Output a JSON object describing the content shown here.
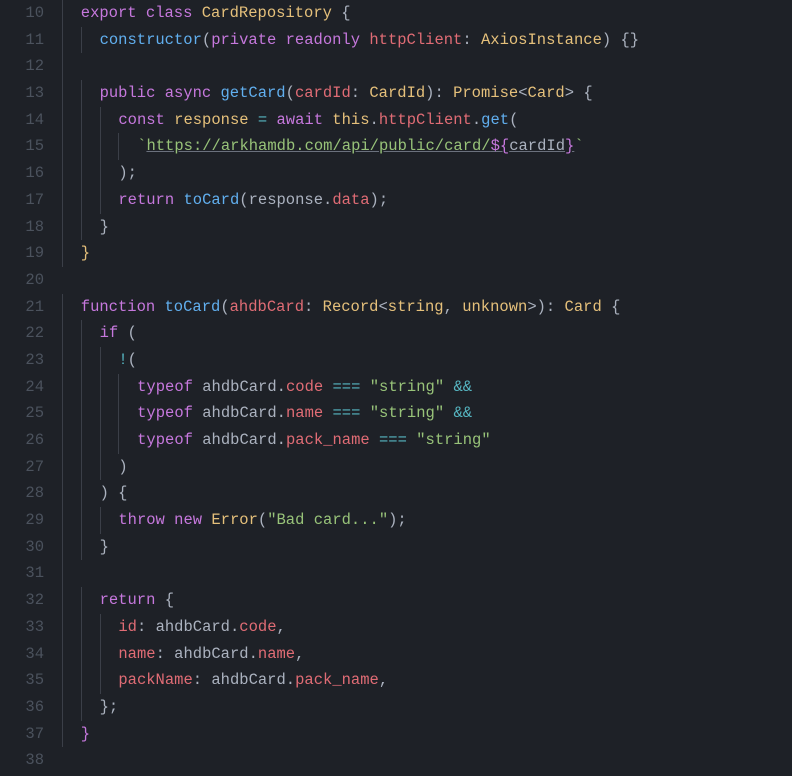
{
  "lines": [
    {
      "num": 10,
      "indent": 1,
      "tokens": [
        {
          "t": "export ",
          "c": "tok-keyword"
        },
        {
          "t": "class ",
          "c": "tok-keyword"
        },
        {
          "t": "CardRepository ",
          "c": "tok-classname"
        },
        {
          "t": "{",
          "c": "tok-brace"
        }
      ]
    },
    {
      "num": 11,
      "indent": 2,
      "tokens": [
        {
          "t": "constructor",
          "c": "tok-funcname"
        },
        {
          "t": "(",
          "c": "tok-punct"
        },
        {
          "t": "private ",
          "c": "tok-keyword"
        },
        {
          "t": "readonly ",
          "c": "tok-keyword"
        },
        {
          "t": "httpClient",
          "c": "tok-param"
        },
        {
          "t": ": ",
          "c": "tok-punct"
        },
        {
          "t": "AxiosInstance",
          "c": "tok-type"
        },
        {
          "t": ") {}",
          "c": "tok-punct"
        }
      ]
    },
    {
      "num": 12,
      "indent": 1,
      "tokens": []
    },
    {
      "num": 13,
      "indent": 2,
      "tokens": [
        {
          "t": "public ",
          "c": "tok-keyword"
        },
        {
          "t": "async ",
          "c": "tok-keyword"
        },
        {
          "t": "getCard",
          "c": "tok-funcname"
        },
        {
          "t": "(",
          "c": "tok-punct"
        },
        {
          "t": "cardId",
          "c": "tok-param"
        },
        {
          "t": ": ",
          "c": "tok-punct"
        },
        {
          "t": "CardId",
          "c": "tok-type"
        },
        {
          "t": "): ",
          "c": "tok-punct"
        },
        {
          "t": "Promise",
          "c": "tok-type"
        },
        {
          "t": "<",
          "c": "tok-punct"
        },
        {
          "t": "Card",
          "c": "tok-type"
        },
        {
          "t": "> {",
          "c": "tok-punct"
        }
      ]
    },
    {
      "num": 14,
      "indent": 3,
      "tokens": [
        {
          "t": "const ",
          "c": "tok-keyword"
        },
        {
          "t": "response ",
          "c": "tok-const"
        },
        {
          "t": "= ",
          "c": "tok-operator"
        },
        {
          "t": "await ",
          "c": "tok-keyword"
        },
        {
          "t": "this",
          "c": "tok-this"
        },
        {
          "t": ".",
          "c": "tok-punct"
        },
        {
          "t": "httpClient",
          "c": "tok-property"
        },
        {
          "t": ".",
          "c": "tok-punct"
        },
        {
          "t": "get",
          "c": "tok-funccall"
        },
        {
          "t": "(",
          "c": "tok-punct"
        }
      ]
    },
    {
      "num": 15,
      "indent": 4,
      "tokens": [
        {
          "t": "`",
          "c": "tok-string"
        },
        {
          "t": "https://arkhamdb.com/api/public/card/",
          "c": "tok-string underline"
        },
        {
          "t": "${",
          "c": "tok-keyword underline"
        },
        {
          "t": "cardId",
          "c": "tok-ident underline"
        },
        {
          "t": "}",
          "c": "tok-keyword underline"
        },
        {
          "t": "`",
          "c": "tok-string"
        }
      ]
    },
    {
      "num": 16,
      "indent": 3,
      "tokens": [
        {
          "t": ");",
          "c": "tok-punct"
        }
      ]
    },
    {
      "num": 17,
      "indent": 3,
      "tokens": [
        {
          "t": "return ",
          "c": "tok-keyword"
        },
        {
          "t": "toCard",
          "c": "tok-funccall"
        },
        {
          "t": "(",
          "c": "tok-punct"
        },
        {
          "t": "response",
          "c": "tok-ident"
        },
        {
          "t": ".",
          "c": "tok-punct"
        },
        {
          "t": "data",
          "c": "tok-property"
        },
        {
          "t": ");",
          "c": "tok-punct"
        }
      ]
    },
    {
      "num": 18,
      "indent": 2,
      "tokens": [
        {
          "t": "}",
          "c": "tok-brace"
        }
      ]
    },
    {
      "num": 19,
      "indent": 1,
      "tokens": [
        {
          "t": "}",
          "c": "tok-brace-y"
        }
      ]
    },
    {
      "num": 20,
      "indent": 0,
      "tokens": []
    },
    {
      "num": 21,
      "indent": 1,
      "tokens": [
        {
          "t": "function ",
          "c": "tok-keyword"
        },
        {
          "t": "toCard",
          "c": "tok-funcname"
        },
        {
          "t": "(",
          "c": "tok-punct"
        },
        {
          "t": "ahdbCard",
          "c": "tok-param"
        },
        {
          "t": ": ",
          "c": "tok-punct"
        },
        {
          "t": "Record",
          "c": "tok-type"
        },
        {
          "t": "<",
          "c": "tok-punct"
        },
        {
          "t": "string",
          "c": "tok-type"
        },
        {
          "t": ", ",
          "c": "tok-punct"
        },
        {
          "t": "unknown",
          "c": "tok-type"
        },
        {
          "t": ">): ",
          "c": "tok-punct"
        },
        {
          "t": "Card ",
          "c": "tok-type"
        },
        {
          "t": "{",
          "c": "tok-brace"
        }
      ]
    },
    {
      "num": 22,
      "indent": 2,
      "tokens": [
        {
          "t": "if ",
          "c": "tok-keyword"
        },
        {
          "t": "(",
          "c": "tok-punct"
        }
      ]
    },
    {
      "num": 23,
      "indent": 3,
      "tokens": [
        {
          "t": "!",
          "c": "tok-operator"
        },
        {
          "t": "(",
          "c": "tok-punct"
        }
      ]
    },
    {
      "num": 24,
      "indent": 4,
      "tokens": [
        {
          "t": "typeof ",
          "c": "tok-keyword"
        },
        {
          "t": "ahdbCard",
          "c": "tok-ident"
        },
        {
          "t": ".",
          "c": "tok-punct"
        },
        {
          "t": "code ",
          "c": "tok-property"
        },
        {
          "t": "=== ",
          "c": "tok-operator"
        },
        {
          "t": "\"string\"",
          "c": "tok-string"
        },
        {
          "t": " && ",
          "c": "tok-operator"
        }
      ]
    },
    {
      "num": 25,
      "indent": 4,
      "tokens": [
        {
          "t": "typeof ",
          "c": "tok-keyword"
        },
        {
          "t": "ahdbCard",
          "c": "tok-ident"
        },
        {
          "t": ".",
          "c": "tok-punct"
        },
        {
          "t": "name ",
          "c": "tok-property"
        },
        {
          "t": "=== ",
          "c": "tok-operator"
        },
        {
          "t": "\"string\"",
          "c": "tok-string"
        },
        {
          "t": " && ",
          "c": "tok-operator"
        }
      ]
    },
    {
      "num": 26,
      "indent": 4,
      "tokens": [
        {
          "t": "typeof ",
          "c": "tok-keyword"
        },
        {
          "t": "ahdbCard",
          "c": "tok-ident"
        },
        {
          "t": ".",
          "c": "tok-punct"
        },
        {
          "t": "pack_name ",
          "c": "tok-property"
        },
        {
          "t": "=== ",
          "c": "tok-operator"
        },
        {
          "t": "\"string\"",
          "c": "tok-string"
        }
      ]
    },
    {
      "num": 27,
      "indent": 3,
      "tokens": [
        {
          "t": ")",
          "c": "tok-punct"
        }
      ]
    },
    {
      "num": 28,
      "indent": 2,
      "tokens": [
        {
          "t": ") {",
          "c": "tok-punct"
        }
      ]
    },
    {
      "num": 29,
      "indent": 3,
      "tokens": [
        {
          "t": "throw ",
          "c": "tok-keyword"
        },
        {
          "t": "new ",
          "c": "tok-keyword"
        },
        {
          "t": "Error",
          "c": "tok-type"
        },
        {
          "t": "(",
          "c": "tok-punct"
        },
        {
          "t": "\"Bad card...\"",
          "c": "tok-string"
        },
        {
          "t": ");",
          "c": "tok-punct"
        }
      ]
    },
    {
      "num": 30,
      "indent": 2,
      "tokens": [
        {
          "t": "}",
          "c": "tok-brace"
        }
      ]
    },
    {
      "num": 31,
      "indent": 1,
      "tokens": []
    },
    {
      "num": 32,
      "indent": 2,
      "tokens": [
        {
          "t": "return ",
          "c": "tok-keyword"
        },
        {
          "t": "{",
          "c": "tok-brace"
        }
      ]
    },
    {
      "num": 33,
      "indent": 3,
      "tokens": [
        {
          "t": "id",
          "c": "tok-property"
        },
        {
          "t": ": ",
          "c": "tok-punct"
        },
        {
          "t": "ahdbCard",
          "c": "tok-ident"
        },
        {
          "t": ".",
          "c": "tok-punct"
        },
        {
          "t": "code",
          "c": "tok-property"
        },
        {
          "t": ",",
          "c": "tok-punct"
        }
      ]
    },
    {
      "num": 34,
      "indent": 3,
      "tokens": [
        {
          "t": "name",
          "c": "tok-property"
        },
        {
          "t": ": ",
          "c": "tok-punct"
        },
        {
          "t": "ahdbCard",
          "c": "tok-ident"
        },
        {
          "t": ".",
          "c": "tok-punct"
        },
        {
          "t": "name",
          "c": "tok-property"
        },
        {
          "t": ",",
          "c": "tok-punct"
        }
      ]
    },
    {
      "num": 35,
      "indent": 3,
      "tokens": [
        {
          "t": "packName",
          "c": "tok-property"
        },
        {
          "t": ": ",
          "c": "tok-punct"
        },
        {
          "t": "ahdbCard",
          "c": "tok-ident"
        },
        {
          "t": ".",
          "c": "tok-punct"
        },
        {
          "t": "pack_name",
          "c": "tok-property"
        },
        {
          "t": ",",
          "c": "tok-punct"
        }
      ]
    },
    {
      "num": 36,
      "indent": 2,
      "tokens": [
        {
          "t": "};",
          "c": "tok-punct"
        }
      ]
    },
    {
      "num": 37,
      "indent": 1,
      "tokens": [
        {
          "t": "}",
          "c": "tok-brace-p"
        }
      ]
    },
    {
      "num": 38,
      "indent": 0,
      "tokens": []
    }
  ],
  "indent_size": 2
}
